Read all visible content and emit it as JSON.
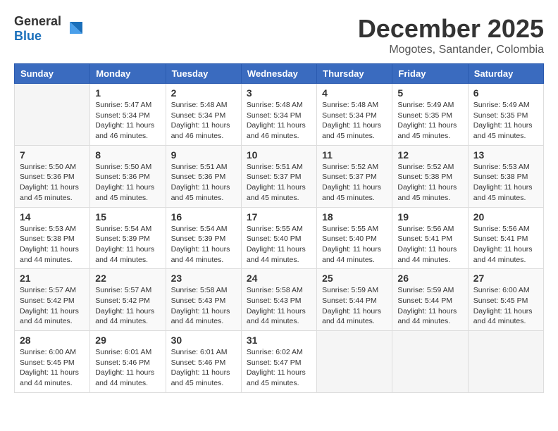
{
  "logo": {
    "general": "General",
    "blue": "Blue"
  },
  "title": "December 2025",
  "subtitle": "Mogotes, Santander, Colombia",
  "weekdays": [
    "Sunday",
    "Monday",
    "Tuesday",
    "Wednesday",
    "Thursday",
    "Friday",
    "Saturday"
  ],
  "weeks": [
    [
      {
        "day": "",
        "info": ""
      },
      {
        "day": "1",
        "info": "Sunrise: 5:47 AM\nSunset: 5:34 PM\nDaylight: 11 hours\nand 46 minutes."
      },
      {
        "day": "2",
        "info": "Sunrise: 5:48 AM\nSunset: 5:34 PM\nDaylight: 11 hours\nand 46 minutes."
      },
      {
        "day": "3",
        "info": "Sunrise: 5:48 AM\nSunset: 5:34 PM\nDaylight: 11 hours\nand 46 minutes."
      },
      {
        "day": "4",
        "info": "Sunrise: 5:48 AM\nSunset: 5:34 PM\nDaylight: 11 hours\nand 45 minutes."
      },
      {
        "day": "5",
        "info": "Sunrise: 5:49 AM\nSunset: 5:35 PM\nDaylight: 11 hours\nand 45 minutes."
      },
      {
        "day": "6",
        "info": "Sunrise: 5:49 AM\nSunset: 5:35 PM\nDaylight: 11 hours\nand 45 minutes."
      }
    ],
    [
      {
        "day": "7",
        "info": "Sunrise: 5:50 AM\nSunset: 5:36 PM\nDaylight: 11 hours\nand 45 minutes."
      },
      {
        "day": "8",
        "info": "Sunrise: 5:50 AM\nSunset: 5:36 PM\nDaylight: 11 hours\nand 45 minutes."
      },
      {
        "day": "9",
        "info": "Sunrise: 5:51 AM\nSunset: 5:36 PM\nDaylight: 11 hours\nand 45 minutes."
      },
      {
        "day": "10",
        "info": "Sunrise: 5:51 AM\nSunset: 5:37 PM\nDaylight: 11 hours\nand 45 minutes."
      },
      {
        "day": "11",
        "info": "Sunrise: 5:52 AM\nSunset: 5:37 PM\nDaylight: 11 hours\nand 45 minutes."
      },
      {
        "day": "12",
        "info": "Sunrise: 5:52 AM\nSunset: 5:38 PM\nDaylight: 11 hours\nand 45 minutes."
      },
      {
        "day": "13",
        "info": "Sunrise: 5:53 AM\nSunset: 5:38 PM\nDaylight: 11 hours\nand 45 minutes."
      }
    ],
    [
      {
        "day": "14",
        "info": "Sunrise: 5:53 AM\nSunset: 5:38 PM\nDaylight: 11 hours\nand 44 minutes."
      },
      {
        "day": "15",
        "info": "Sunrise: 5:54 AM\nSunset: 5:39 PM\nDaylight: 11 hours\nand 44 minutes."
      },
      {
        "day": "16",
        "info": "Sunrise: 5:54 AM\nSunset: 5:39 PM\nDaylight: 11 hours\nand 44 minutes."
      },
      {
        "day": "17",
        "info": "Sunrise: 5:55 AM\nSunset: 5:40 PM\nDaylight: 11 hours\nand 44 minutes."
      },
      {
        "day": "18",
        "info": "Sunrise: 5:55 AM\nSunset: 5:40 PM\nDaylight: 11 hours\nand 44 minutes."
      },
      {
        "day": "19",
        "info": "Sunrise: 5:56 AM\nSunset: 5:41 PM\nDaylight: 11 hours\nand 44 minutes."
      },
      {
        "day": "20",
        "info": "Sunrise: 5:56 AM\nSunset: 5:41 PM\nDaylight: 11 hours\nand 44 minutes."
      }
    ],
    [
      {
        "day": "21",
        "info": "Sunrise: 5:57 AM\nSunset: 5:42 PM\nDaylight: 11 hours\nand 44 minutes."
      },
      {
        "day": "22",
        "info": "Sunrise: 5:57 AM\nSunset: 5:42 PM\nDaylight: 11 hours\nand 44 minutes."
      },
      {
        "day": "23",
        "info": "Sunrise: 5:58 AM\nSunset: 5:43 PM\nDaylight: 11 hours\nand 44 minutes."
      },
      {
        "day": "24",
        "info": "Sunrise: 5:58 AM\nSunset: 5:43 PM\nDaylight: 11 hours\nand 44 minutes."
      },
      {
        "day": "25",
        "info": "Sunrise: 5:59 AM\nSunset: 5:44 PM\nDaylight: 11 hours\nand 44 minutes."
      },
      {
        "day": "26",
        "info": "Sunrise: 5:59 AM\nSunset: 5:44 PM\nDaylight: 11 hours\nand 44 minutes."
      },
      {
        "day": "27",
        "info": "Sunrise: 6:00 AM\nSunset: 5:45 PM\nDaylight: 11 hours\nand 44 minutes."
      }
    ],
    [
      {
        "day": "28",
        "info": "Sunrise: 6:00 AM\nSunset: 5:45 PM\nDaylight: 11 hours\nand 44 minutes."
      },
      {
        "day": "29",
        "info": "Sunrise: 6:01 AM\nSunset: 5:46 PM\nDaylight: 11 hours\nand 44 minutes."
      },
      {
        "day": "30",
        "info": "Sunrise: 6:01 AM\nSunset: 5:46 PM\nDaylight: 11 hours\nand 45 minutes."
      },
      {
        "day": "31",
        "info": "Sunrise: 6:02 AM\nSunset: 5:47 PM\nDaylight: 11 hours\nand 45 minutes."
      },
      {
        "day": "",
        "info": ""
      },
      {
        "day": "",
        "info": ""
      },
      {
        "day": "",
        "info": ""
      }
    ]
  ]
}
